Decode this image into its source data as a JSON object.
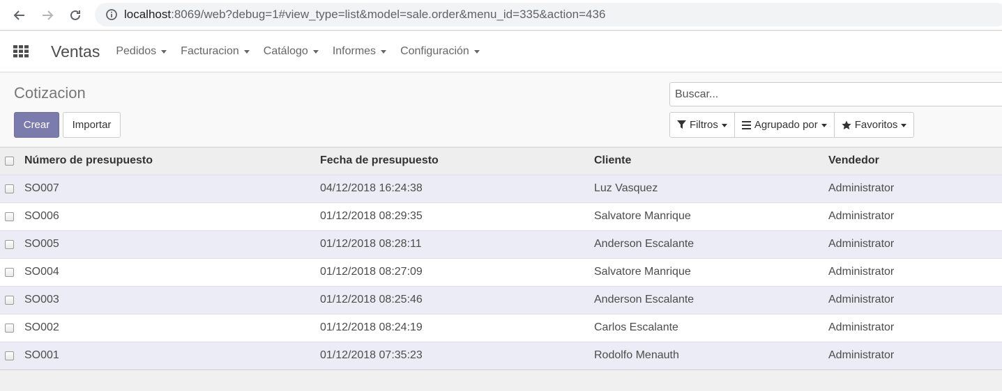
{
  "browser": {
    "url_host": "localhost",
    "url_rest": ":8069/web?debug=1#view_type=list&model=sale.order&menu_id=335&action=436"
  },
  "navbar": {
    "brand": "Ventas",
    "menu": [
      {
        "label": "Pedidos"
      },
      {
        "label": "Facturacion"
      },
      {
        "label": "Catálogo"
      },
      {
        "label": "Informes"
      },
      {
        "label": "Configuración"
      }
    ]
  },
  "control_panel": {
    "title": "Cotizacion",
    "create_label": "Crear",
    "import_label": "Importar",
    "search_placeholder": "Buscar...",
    "filters_label": "Filtros",
    "groupby_label": "Agrupado por",
    "favorites_label": "Favoritos"
  },
  "table": {
    "headers": [
      "Número de presupuesto",
      "Fecha de presupuesto",
      "Cliente",
      "Vendedor"
    ],
    "rows": [
      {
        "number": "SO007",
        "date": "04/12/2018 16:24:38",
        "client": "Luz Vasquez",
        "seller": "Administrator"
      },
      {
        "number": "SO006",
        "date": "01/12/2018 08:29:35",
        "client": "Salvatore Manrique",
        "seller": "Administrator"
      },
      {
        "number": "SO005",
        "date": "01/12/2018 08:28:11",
        "client": "Anderson Escalante",
        "seller": "Administrator"
      },
      {
        "number": "SO004",
        "date": "01/12/2018 08:27:09",
        "client": "Salvatore Manrique",
        "seller": "Administrator"
      },
      {
        "number": "SO003",
        "date": "01/12/2018 08:25:46",
        "client": "Anderson Escalante",
        "seller": "Administrator"
      },
      {
        "number": "SO002",
        "date": "01/12/2018 08:24:19",
        "client": "Carlos Escalante",
        "seller": "Administrator"
      },
      {
        "number": "SO001",
        "date": "01/12/2018 07:35:23",
        "client": "Rodolfo Menauth",
        "seller": "Administrator"
      }
    ]
  },
  "colors": {
    "primary": "#7c7bad",
    "odd_row": "#ececf6"
  }
}
